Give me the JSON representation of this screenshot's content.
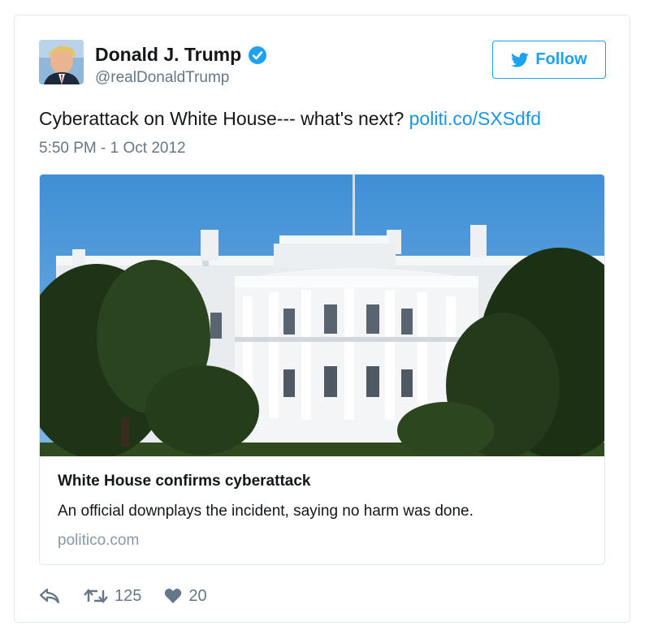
{
  "author": {
    "name": "Donald J. Trump",
    "handle": "@realDonaldTrump"
  },
  "follow_button": {
    "label": "Follow"
  },
  "tweet": {
    "text": "Cyberattack on White House--- what's next?",
    "link": "politi.co/SXSdfd",
    "timestamp": "5:50 PM - 1 Oct 2012"
  },
  "card": {
    "title": "White House confirms cyberattack",
    "description": "An official downplays the incident, saying no harm was done.",
    "domain": "politico.com",
    "image_subject": "white-house-photo"
  },
  "actions": {
    "retweets": "125",
    "likes": "20"
  },
  "colors": {
    "brand_blue": "#1da1f2",
    "link_blue": "#1b95e0",
    "muted_text": "#657786",
    "border": "#e1e8ed"
  },
  "icons": [
    "verified-icon",
    "twitter-bird-icon",
    "reply-icon",
    "retweet-icon",
    "heart-icon"
  ]
}
